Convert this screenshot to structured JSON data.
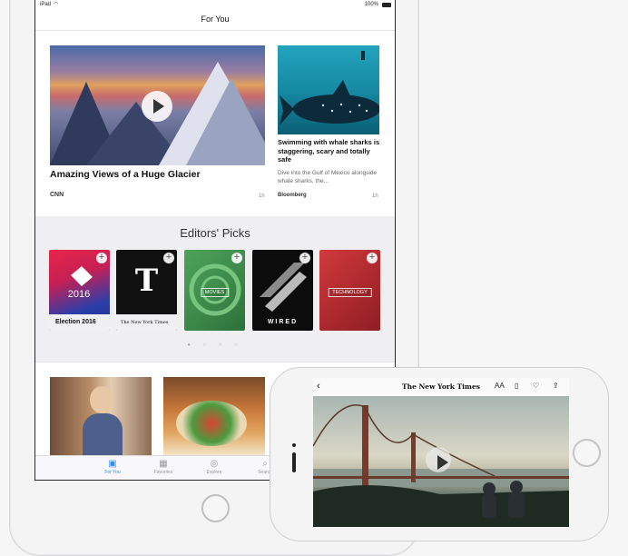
{
  "status_bar": {
    "carrier": "iPad",
    "battery": "100%"
  },
  "nav": {
    "title": "For You"
  },
  "story_main": {
    "headline": "Amazing Views of a Huge Glacier",
    "source": "CNN",
    "age": "1h"
  },
  "story_side": {
    "headline": "Swimming with whale sharks is staggering, scary and totally safe",
    "summary": "Dive into the Gulf of Mexico alongside whale sharks, the...",
    "source": "Bloomberg",
    "age": "1h"
  },
  "editors_picks": {
    "title": "Editors' Picks",
    "items": [
      {
        "caption": "Election 2016",
        "art_text": "2016"
      },
      {
        "caption": "The New York Times"
      },
      {
        "label": "MOVIES"
      },
      {
        "label": "WIRED"
      },
      {
        "label": "TECHNOLOGY"
      }
    ],
    "page_dots": "● ○ ○ ○"
  },
  "tabs": [
    {
      "label": "For You",
      "icon": "for-you-icon"
    },
    {
      "label": "Favorites",
      "icon": "favorites-icon"
    },
    {
      "label": "Explore",
      "icon": "explore-icon"
    },
    {
      "label": "Search",
      "icon": "search-icon"
    }
  ],
  "iphone": {
    "publication": "The New York Times",
    "text_size_icon": "AA"
  },
  "colors": {
    "accent": "#2e8ef7"
  }
}
